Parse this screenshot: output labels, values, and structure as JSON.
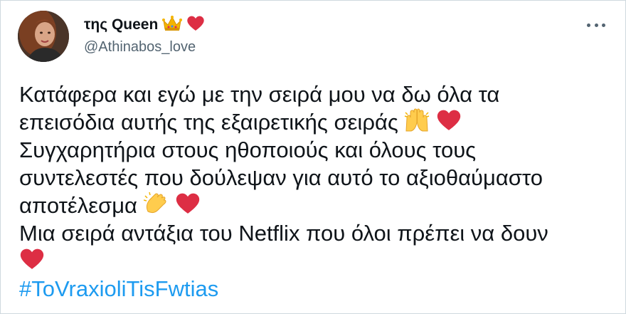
{
  "author": {
    "display_name": "της Queen",
    "handle": "@Athinabos_love",
    "avatar_icon": "profile-photo",
    "name_emojis": [
      "crown-icon",
      "red-heart-icon"
    ]
  },
  "menu": {
    "icon": "more-options-icon"
  },
  "tweet": {
    "lines": [
      "Κατάφερα και εγώ με την σειρά μου να δω όλα τα",
      "επεισόδια αυτής της εξαιρετικής σειράς",
      "Συγχαρητήρια στους ηθοποιούς και όλους τους",
      "συντελεστές που δούλεψαν για αυτό το αξιοθαύμαστο",
      "αποτέλεσμα",
      "Μια σειρά αντάξια του Netflix που όλοι πρέπει να δουν"
    ],
    "hashtag": "#ToVraxioliTisFwtias",
    "emojis": {
      "line2": [
        "raising-hands-icon",
        "red-heart-icon"
      ],
      "line5": [
        "clapping-hands-icon",
        "red-heart-icon"
      ],
      "line7": [
        "red-heart-icon"
      ]
    }
  },
  "colors": {
    "text": "#0f1419",
    "secondary": "#536471",
    "link": "#1d9bf0",
    "heart": "#e0245e",
    "border": "#cfd9de"
  }
}
